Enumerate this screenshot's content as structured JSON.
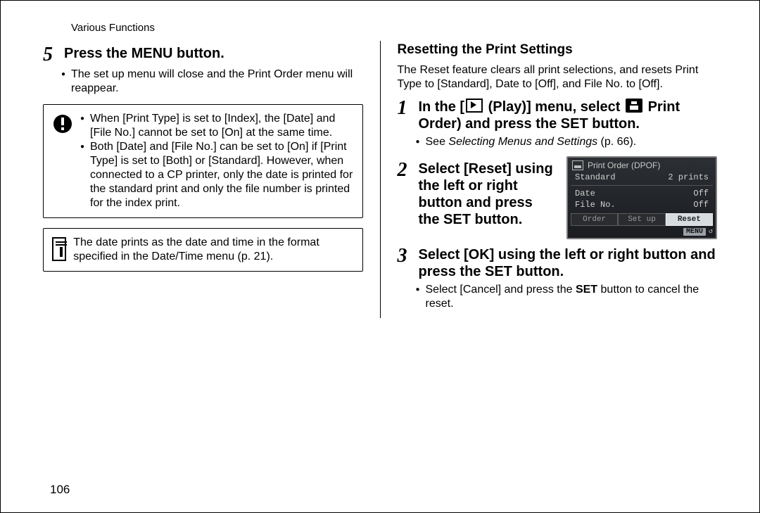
{
  "header": {
    "section": "Various Functions"
  },
  "page_number": "106",
  "left": {
    "step5": {
      "num": "5",
      "title": "Press the MENU button.",
      "bullets": [
        "The set up menu will close and the Print Order menu will reappear."
      ]
    },
    "warning": {
      "bullets": [
        "When [Print Type] is set to [Index], the [Date] and [File No.] cannot be set to [On] at the same time.",
        "Both [Date] and [File No.] can be set to [On] if [Print Type] is set to [Both] or [Standard]. However, when connected to a CP printer, only the date is printed for the standard print and only the file number is printed for the index print."
      ]
    },
    "memo": {
      "text": "The date prints as the date and time in the format specified in the Date/Time menu (p. 21)."
    }
  },
  "right": {
    "title": "Resetting the Print Settings",
    "intro": "The Reset feature clears all print selections, and resets Print Type to [Standard], Date to [Off], and File No. to [Off].",
    "step1": {
      "num": "1",
      "title_pre": "In the [",
      "title_mid1": " (Play)] menu, select ",
      "title_post": " Print Order) and press the SET button.",
      "bullet_pre": "See ",
      "bullet_ref": "Selecting Menus and Settings",
      "bullet_post": " (p. 66)."
    },
    "step2": {
      "num": "2",
      "title": "Select [Reset] using the left or right button and press the SET button."
    },
    "step3": {
      "num": "3",
      "title": "Select [OK] using the left or right button and press the SET button.",
      "bullet_pre": "Select [Cancel] and press the ",
      "bullet_bold": "SET",
      "bullet_post": " button to cancel the reset."
    },
    "lcd": {
      "header": "Print Order (DPOF)",
      "row1_label": "Standard",
      "row1_value": "2 prints",
      "row2_label": "Date",
      "row2_value": "Off",
      "row3_label": "File No.",
      "row3_value": "Off",
      "tab_order": "Order",
      "tab_setup": "Set up",
      "tab_reset": "Reset",
      "menu_label": "MENU"
    }
  }
}
